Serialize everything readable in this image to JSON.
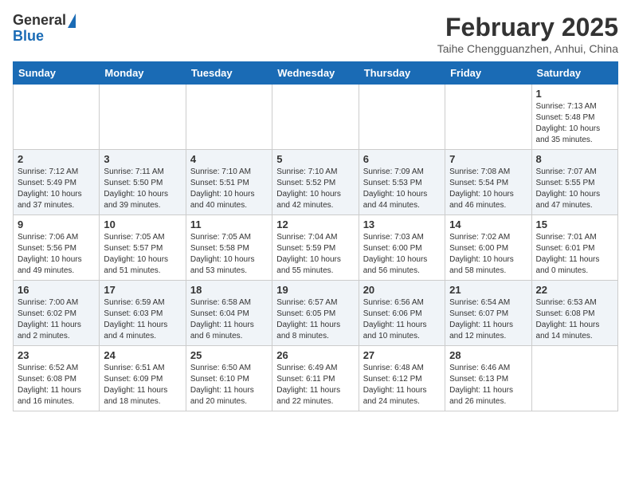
{
  "header": {
    "logo_line1": "General",
    "logo_line2": "Blue",
    "month_year": "February 2025",
    "location": "Taihe Chengguanzhen, Anhui, China"
  },
  "days_of_week": [
    "Sunday",
    "Monday",
    "Tuesday",
    "Wednesday",
    "Thursday",
    "Friday",
    "Saturday"
  ],
  "weeks": [
    [
      {
        "day": "",
        "info": ""
      },
      {
        "day": "",
        "info": ""
      },
      {
        "day": "",
        "info": ""
      },
      {
        "day": "",
        "info": ""
      },
      {
        "day": "",
        "info": ""
      },
      {
        "day": "",
        "info": ""
      },
      {
        "day": "1",
        "info": "Sunrise: 7:13 AM\nSunset: 5:48 PM\nDaylight: 10 hours and 35 minutes."
      }
    ],
    [
      {
        "day": "2",
        "info": "Sunrise: 7:12 AM\nSunset: 5:49 PM\nDaylight: 10 hours and 37 minutes."
      },
      {
        "day": "3",
        "info": "Sunrise: 7:11 AM\nSunset: 5:50 PM\nDaylight: 10 hours and 39 minutes."
      },
      {
        "day": "4",
        "info": "Sunrise: 7:10 AM\nSunset: 5:51 PM\nDaylight: 10 hours and 40 minutes."
      },
      {
        "day": "5",
        "info": "Sunrise: 7:10 AM\nSunset: 5:52 PM\nDaylight: 10 hours and 42 minutes."
      },
      {
        "day": "6",
        "info": "Sunrise: 7:09 AM\nSunset: 5:53 PM\nDaylight: 10 hours and 44 minutes."
      },
      {
        "day": "7",
        "info": "Sunrise: 7:08 AM\nSunset: 5:54 PM\nDaylight: 10 hours and 46 minutes."
      },
      {
        "day": "8",
        "info": "Sunrise: 7:07 AM\nSunset: 5:55 PM\nDaylight: 10 hours and 47 minutes."
      }
    ],
    [
      {
        "day": "9",
        "info": "Sunrise: 7:06 AM\nSunset: 5:56 PM\nDaylight: 10 hours and 49 minutes."
      },
      {
        "day": "10",
        "info": "Sunrise: 7:05 AM\nSunset: 5:57 PM\nDaylight: 10 hours and 51 minutes."
      },
      {
        "day": "11",
        "info": "Sunrise: 7:05 AM\nSunset: 5:58 PM\nDaylight: 10 hours and 53 minutes."
      },
      {
        "day": "12",
        "info": "Sunrise: 7:04 AM\nSunset: 5:59 PM\nDaylight: 10 hours and 55 minutes."
      },
      {
        "day": "13",
        "info": "Sunrise: 7:03 AM\nSunset: 6:00 PM\nDaylight: 10 hours and 56 minutes."
      },
      {
        "day": "14",
        "info": "Sunrise: 7:02 AM\nSunset: 6:00 PM\nDaylight: 10 hours and 58 minutes."
      },
      {
        "day": "15",
        "info": "Sunrise: 7:01 AM\nSunset: 6:01 PM\nDaylight: 11 hours and 0 minutes."
      }
    ],
    [
      {
        "day": "16",
        "info": "Sunrise: 7:00 AM\nSunset: 6:02 PM\nDaylight: 11 hours and 2 minutes."
      },
      {
        "day": "17",
        "info": "Sunrise: 6:59 AM\nSunset: 6:03 PM\nDaylight: 11 hours and 4 minutes."
      },
      {
        "day": "18",
        "info": "Sunrise: 6:58 AM\nSunset: 6:04 PM\nDaylight: 11 hours and 6 minutes."
      },
      {
        "day": "19",
        "info": "Sunrise: 6:57 AM\nSunset: 6:05 PM\nDaylight: 11 hours and 8 minutes."
      },
      {
        "day": "20",
        "info": "Sunrise: 6:56 AM\nSunset: 6:06 PM\nDaylight: 11 hours and 10 minutes."
      },
      {
        "day": "21",
        "info": "Sunrise: 6:54 AM\nSunset: 6:07 PM\nDaylight: 11 hours and 12 minutes."
      },
      {
        "day": "22",
        "info": "Sunrise: 6:53 AM\nSunset: 6:08 PM\nDaylight: 11 hours and 14 minutes."
      }
    ],
    [
      {
        "day": "23",
        "info": "Sunrise: 6:52 AM\nSunset: 6:08 PM\nDaylight: 11 hours and 16 minutes."
      },
      {
        "day": "24",
        "info": "Sunrise: 6:51 AM\nSunset: 6:09 PM\nDaylight: 11 hours and 18 minutes."
      },
      {
        "day": "25",
        "info": "Sunrise: 6:50 AM\nSunset: 6:10 PM\nDaylight: 11 hours and 20 minutes."
      },
      {
        "day": "26",
        "info": "Sunrise: 6:49 AM\nSunset: 6:11 PM\nDaylight: 11 hours and 22 minutes."
      },
      {
        "day": "27",
        "info": "Sunrise: 6:48 AM\nSunset: 6:12 PM\nDaylight: 11 hours and 24 minutes."
      },
      {
        "day": "28",
        "info": "Sunrise: 6:46 AM\nSunset: 6:13 PM\nDaylight: 11 hours and 26 minutes."
      },
      {
        "day": "",
        "info": ""
      }
    ]
  ]
}
